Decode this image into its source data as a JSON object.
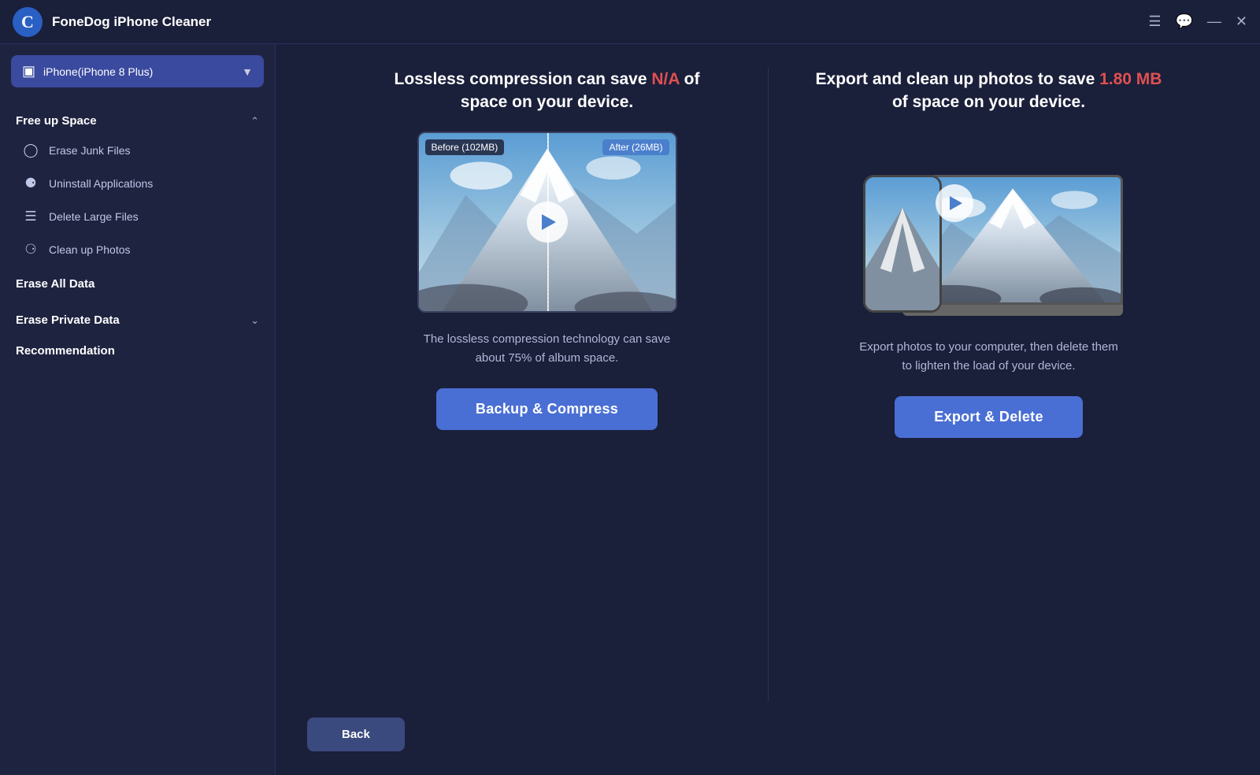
{
  "titlebar": {
    "app_name": "FoneDog iPhone Cleaner",
    "controls": {
      "menu_icon": "☰",
      "chat_icon": "💬",
      "minimize_icon": "—",
      "close_icon": "✕"
    }
  },
  "device_selector": {
    "label": "iPhone(iPhone 8 Plus)",
    "icon": "📱"
  },
  "sidebar": {
    "free_up_space": {
      "title": "Free up Space",
      "expanded": true,
      "items": [
        {
          "label": "Erase Junk Files",
          "icon": "clock"
        },
        {
          "label": "Uninstall Applications",
          "icon": "apps"
        },
        {
          "label": "Delete Large Files",
          "icon": "list"
        },
        {
          "label": "Clean up Photos",
          "icon": "photo"
        }
      ]
    },
    "erase_all_data": {
      "title": "Erase All Data"
    },
    "erase_private_data": {
      "title": "Erase Private Data",
      "expanded": false
    },
    "recommendation": {
      "title": "Recommendation"
    }
  },
  "left_card": {
    "heading_prefix": "Lossless compression can save ",
    "heading_highlight": "N/A",
    "heading_suffix": " of space on your device.",
    "before_label": "Before (102MB)",
    "after_label": "After (26MB)",
    "description": "The lossless compression technology can save about 75% of album space.",
    "button_label": "Backup & Compress"
  },
  "right_card": {
    "heading_prefix": "Export and clean up photos to save ",
    "heading_highlight": "1.80 MB",
    "heading_suffix": " of space on your device.",
    "description": "Export photos to your computer, then delete them to lighten the load of your device.",
    "button_label": "Export & Delete"
  },
  "back_button": {
    "label": "Back"
  }
}
